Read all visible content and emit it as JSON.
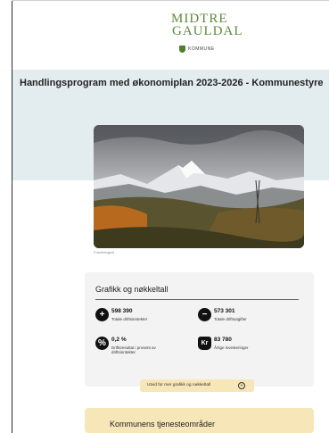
{
  "logo": {
    "line1": "MIDTRE",
    "line2": "GAULDAL",
    "sub": "KOMMUNE"
  },
  "page": {
    "title": "Handlingsprogram med økonomiplan 2023-2026 - Kommunestyre"
  },
  "hero": {
    "caption": "Foto/fotograf",
    "icon": "mountain-photo"
  },
  "keyfigures": {
    "title": "Grafikk og nøkkeltall",
    "items": [
      {
        "icon": "plus-circle-icon",
        "symbol": "+",
        "value": "598 390",
        "label": "Totale driftsinntekter"
      },
      {
        "icon": "minus-circle-icon",
        "symbol": "−",
        "value": "573 301",
        "label": "Totale driftsutgifter"
      },
      {
        "icon": "percent-circle-icon",
        "symbol": "%",
        "value": "0,2 %",
        "label": "Driftsresultat i prosent av driftsinntekter"
      },
      {
        "icon": "money-bag-icon",
        "symbol": "Kr",
        "value": "83 780",
        "label": "Årlige investeringer"
      }
    ],
    "expand_label": "Utvid for mer grafikk og nøkkeltall",
    "expand_icon": "plus-circle-outline-icon"
  },
  "services": {
    "title": "Kommunens tjenesteområder"
  },
  "colors": {
    "band": "#e3ecef",
    "logo_green": "#5e8a3a",
    "card": "#f3f3f3",
    "accent_yellow": "#f7e6b8"
  }
}
